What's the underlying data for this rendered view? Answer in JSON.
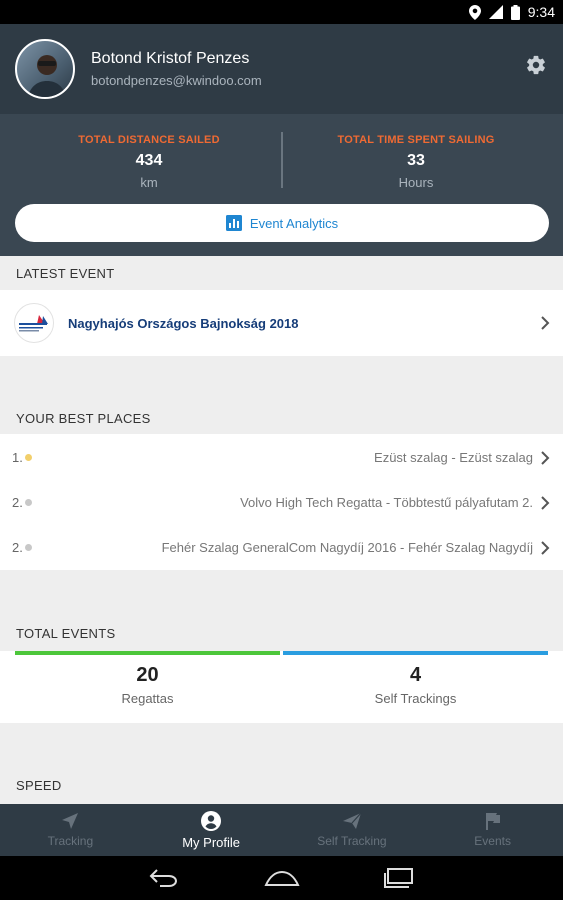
{
  "status_bar": {
    "time": "9:34",
    "icons": [
      "location-icon",
      "signal-icon",
      "battery-icon"
    ]
  },
  "profile": {
    "name": "Botond Kristof Penzes",
    "email": "botondpenzes@kwindoo.com",
    "avatar": "avatar-photo",
    "settings_icon": "gear-icon"
  },
  "stats": {
    "distance": {
      "label": "TOTAL DISTANCE SAILED",
      "value": "434",
      "unit": "km"
    },
    "time": {
      "label": "TOTAL TIME SPENT SAILING",
      "value": "33",
      "unit": "Hours"
    },
    "analytics_button": "Event Analytics",
    "analytics_icon": "bar-chart-icon"
  },
  "latest_event": {
    "title": "LATEST EVENT",
    "name": "Nagyhajós Országos Bajnokság 2018"
  },
  "best_places": {
    "title": "YOUR BEST PLACES",
    "items": [
      {
        "rank": "1.",
        "medal": "gold",
        "name": "Ezüst szalag - Ezüst szalag"
      },
      {
        "rank": "2.",
        "medal": "silver",
        "name": "Volvo High Tech Regatta - Többtestű pályafutam 2."
      },
      {
        "rank": "2.",
        "medal": "silver",
        "name": "Fehér Szalag GeneralCom Nagydíj 2016 - Fehér Szalag Nagydíj"
      }
    ]
  },
  "total_events": {
    "title": "TOTAL EVENTS",
    "regattas": {
      "count": "20",
      "label": "Regattas"
    },
    "self_trackings": {
      "count": "4",
      "label": "Self Trackings"
    }
  },
  "speed": {
    "title": "SPEED"
  },
  "bottom_nav": [
    {
      "label": "Tracking",
      "icon": "navigation-arrow-icon",
      "active": false
    },
    {
      "label": "My Profile",
      "icon": "account-circle-icon",
      "active": true
    },
    {
      "label": "Self Tracking",
      "icon": "paper-plane-icon",
      "active": false
    },
    {
      "label": "Events",
      "icon": "flag-icon",
      "active": false
    }
  ],
  "colors": {
    "header_bg": "#2f3b45",
    "stats_bg": "#3a4752",
    "accent_orange": "#ef6a33",
    "link_blue": "#1f86d1",
    "event_name_blue": "#163d79",
    "green_bar": "#4cc63a",
    "blue_bar": "#2a9de0",
    "gold_medal": "#f2cf6b",
    "silver_medal": "#c8c8c8"
  }
}
